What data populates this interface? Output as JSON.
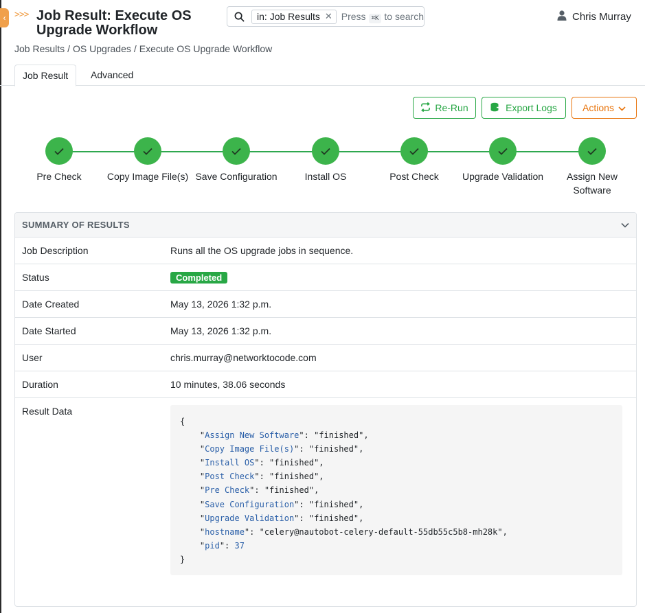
{
  "app": {
    "brand_glyph": ">>>",
    "page_title": "Job Result: Execute OS Upgrade Workflow"
  },
  "search": {
    "chip_label": "in: Job Results",
    "hint_before": "Press",
    "hint_key": "⌘K",
    "hint_after": "to search"
  },
  "user": {
    "name": "Chris Murray"
  },
  "breadcrumb": [
    "Job Results",
    "OS Upgrades",
    "Execute OS Upgrade Workflow"
  ],
  "tabs": [
    {
      "label": "Job Result",
      "active": true
    },
    {
      "label": "Advanced",
      "active": false
    }
  ],
  "toolbar": {
    "rerun_label": "Re-Run",
    "export_label": "Export Logs",
    "actions_label": "Actions"
  },
  "steps": [
    {
      "label": "Pre Check",
      "status": "finished"
    },
    {
      "label": "Copy Image File(s)",
      "status": "finished"
    },
    {
      "label": "Save Configuration",
      "status": "finished"
    },
    {
      "label": "Install OS",
      "status": "finished"
    },
    {
      "label": "Post Check",
      "status": "finished"
    },
    {
      "label": "Upgrade Validation",
      "status": "finished"
    },
    {
      "label": "Assign New Software",
      "status": "finished"
    }
  ],
  "summary": {
    "title": "SUMMARY OF RESULTS",
    "rows": [
      {
        "key": "Job Description",
        "value": "Runs all the OS upgrade jobs in sequence."
      },
      {
        "key": "Status",
        "value": "Completed"
      },
      {
        "key": "Date Created",
        "value": "May 13, 2026 1:32 p.m."
      },
      {
        "key": "Date Started",
        "value": "May 13, 2026 1:32 p.m."
      },
      {
        "key": "User",
        "value": "chris.murray@networktocode.com"
      },
      {
        "key": "Duration",
        "value": "10 minutes, 38.06 seconds"
      }
    ],
    "result_label": "Result Data",
    "result_data": [
      {
        "k": "Assign New Software",
        "v": "finished"
      },
      {
        "k": "Copy Image File(s)",
        "v": "finished"
      },
      {
        "k": "Install OS",
        "v": "finished"
      },
      {
        "k": "Post Check",
        "v": "finished"
      },
      {
        "k": "Pre Check",
        "v": "finished"
      },
      {
        "k": "Save Configuration",
        "v": "finished"
      },
      {
        "k": "Upgrade Validation",
        "v": "finished"
      },
      {
        "k": "hostname",
        "v": "celery@nautobot-celery-default-55db55c5b8-mh28k"
      },
      {
        "k": "pid",
        "v": 37
      }
    ]
  },
  "colors": {
    "accent_orange": "#f0a04b",
    "success_green": "#28a745",
    "step_green": "#3cb44b",
    "actions_orange": "#e8740c"
  }
}
